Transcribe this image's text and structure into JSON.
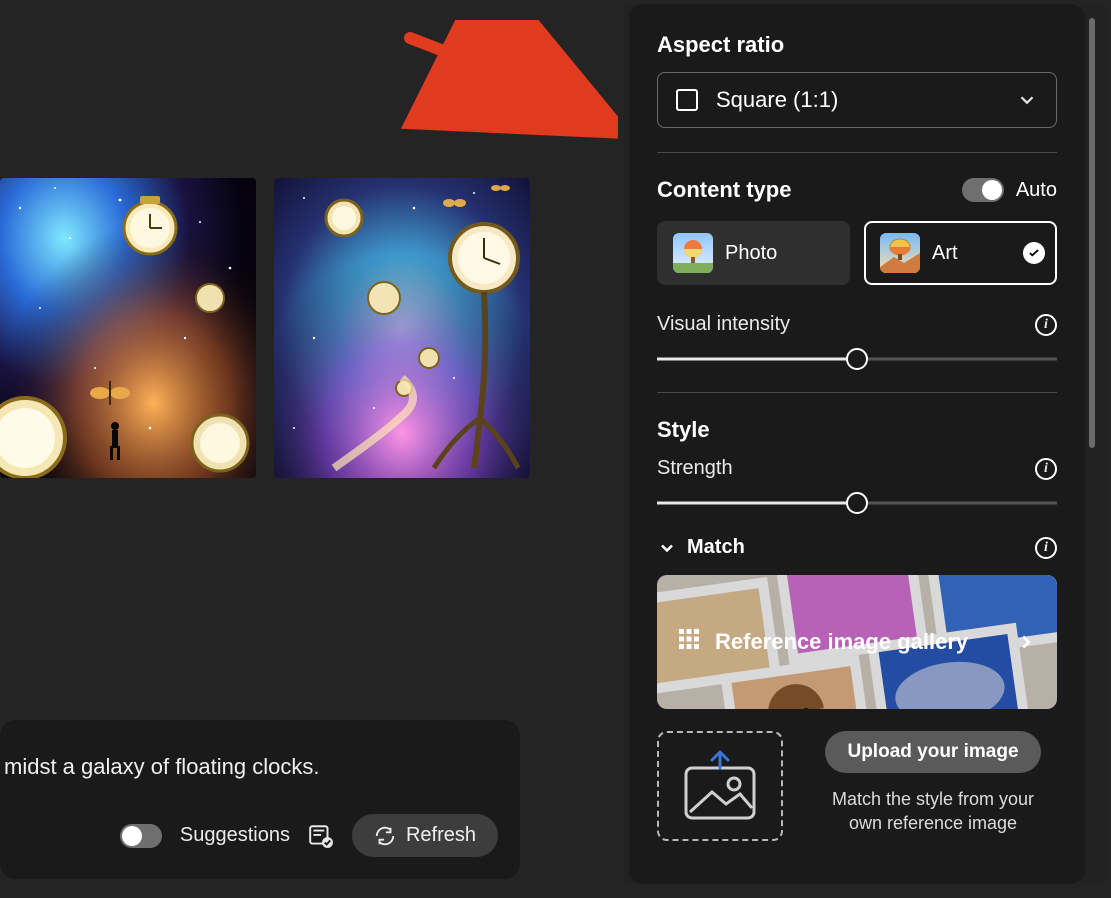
{
  "prompt_fragment": "midst a galaxy of floating clocks.",
  "prompt_bar": {
    "suggestions_label": "Suggestions",
    "refresh_label": "Refresh"
  },
  "panel": {
    "aspect_ratio": {
      "label": "Aspect ratio",
      "value": "Square (1:1)"
    },
    "content_type": {
      "label": "Content type",
      "auto_label": "Auto",
      "options": [
        {
          "key": "photo",
          "label": "Photo",
          "selected": false
        },
        {
          "key": "art",
          "label": "Art",
          "selected": true
        }
      ]
    },
    "visual_intensity": {
      "label": "Visual intensity",
      "value_percent": 50
    },
    "style": {
      "heading": "Style",
      "strength_label": "Strength",
      "strength_percent": 50,
      "match_label": "Match",
      "gallery_label": "Reference image gallery",
      "upload_button": "Upload your image",
      "upload_desc_line1": "Match the style from your",
      "upload_desc_line2": "own reference image"
    }
  }
}
